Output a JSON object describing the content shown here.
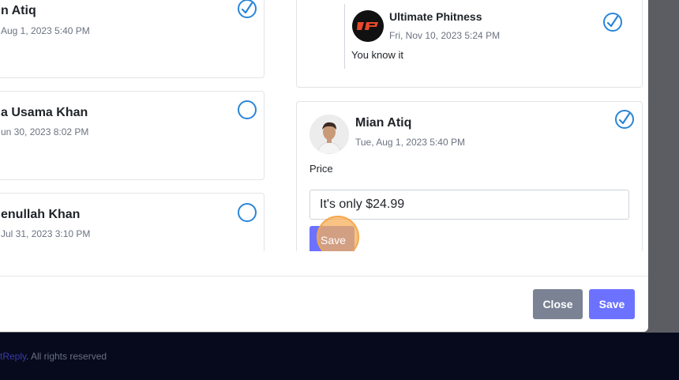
{
  "left_column": {
    "cards": [
      {
        "name": "n Atiq",
        "date": "Aug 1, 2023 5:40 PM",
        "checked": true
      },
      {
        "name": "a Usama Khan",
        "date": "un 30, 2023 8:02 PM",
        "checked": false
      },
      {
        "name": "enullah Khan",
        "date": "Jul 31, 2023 3:10 PM",
        "checked": false
      }
    ]
  },
  "right_column": {
    "reply_card": {
      "author": "Ultimate Phitness",
      "logo_text": "UP",
      "date": "Fri, Nov 10, 2023 5:24 PM",
      "message": "You know it",
      "checked": true
    },
    "comment_card": {
      "author": "Mian Atiq",
      "date": "Tue, Aug 1, 2023 5:40 PM",
      "message": "Price",
      "reply_input_value": "It's only $24.99",
      "save_label": "Save",
      "checked": true
    }
  },
  "modal_footer": {
    "close_label": "Close",
    "save_label": "Save"
  },
  "page_footer": {
    "brand": "tReply",
    "rights": ". All rights reserved"
  },
  "colors": {
    "accent": "#6c72ff",
    "close_button": "#7a8294",
    "checkbox": "#2a85d8",
    "footer_bg": "#060a1c",
    "brand_link": "#3b3ba8"
  }
}
